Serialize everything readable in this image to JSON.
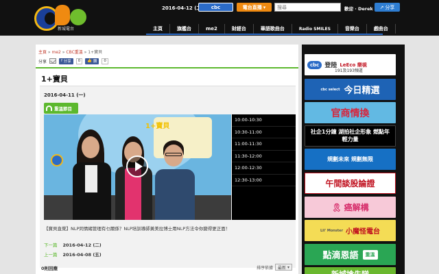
{
  "header": {
    "logo_text": "cbc",
    "logo_sub": "新城電台",
    "date": "2016-04-12 (二)",
    "cbc_button": "cbc",
    "live_button": "電台直播",
    "search_placeholder": "搜尋",
    "welcome": "歡迎 · Derek",
    "share_button": "分享"
  },
  "nav": {
    "items": [
      {
        "label": "主頁"
      },
      {
        "label": "旗艦台"
      },
      {
        "label": "me2"
      },
      {
        "label": "財經台"
      },
      {
        "label": "華語歌曲台"
      },
      {
        "label": "Radio SMILES"
      },
      {
        "label": "音樂台"
      },
      {
        "label": "戲曲台"
      }
    ]
  },
  "breadcrumb": {
    "items": [
      "主頁",
      "me2",
      "CBC重溫",
      "1+寶貝"
    ],
    "separator": " » "
  },
  "share": {
    "label": "分享",
    "fb_share": "分享",
    "fb_share_count": "0",
    "fb_like": "讚",
    "fb_like_count": "0"
  },
  "page_title": "1+寶貝",
  "episode": {
    "date": "2016-04-11 (一)",
    "listen_label": "重溫節目",
    "video_title": "1+寶貝",
    "description": "【寶貝直覺】NLP同情緒管理有乜關係？NLP培訓導師黃美拉博士用NLP方法令你變得更正面！",
    "prev_label": "下一篇",
    "prev_date": "2016-04-12 (二)",
    "next_label": "上一篇",
    "next_date": "2016-04-08 (五)"
  },
  "schedule": [
    "10:00-10:30",
    "10:30-11:00",
    "11:00-11:30",
    "11:30-12:00",
    "12:00-12:30",
    "12:30-13:00"
  ],
  "comments": {
    "count_label": "0則回應",
    "sort_label": "排序依據",
    "sort_value": "最新"
  },
  "sidebar": {
    "banners": [
      {
        "id": "b1",
        "text": "登陸",
        "tag": "cbc",
        "extra": "LeEco 樂視",
        "sub": "191及193頻道"
      },
      {
        "id": "b2",
        "text": "今日精選",
        "tag": "cbc select"
      },
      {
        "id": "b3",
        "text": "官商情換"
      },
      {
        "id": "b4",
        "text": "社企1分鐘 湖拍社企形象 燃點年輕力量"
      },
      {
        "id": "b5",
        "text": "規劃未來 規劃無限"
      },
      {
        "id": "b6",
        "text": "午間談股論證"
      },
      {
        "id": "b7",
        "text": "癌解構"
      },
      {
        "id": "b8",
        "text": "小魔怪電台",
        "tag": "Lil' Monster"
      },
      {
        "id": "b9",
        "text": "點滴恩語",
        "tag": "重溫"
      },
      {
        "id": "b10",
        "text": "新城搶先睇"
      }
    ]
  },
  "colors": {
    "brand_blue": "#2b6bc7",
    "brand_orange": "#ef8a11",
    "accent_green": "#5cb82e",
    "header_bg": "#111111"
  }
}
